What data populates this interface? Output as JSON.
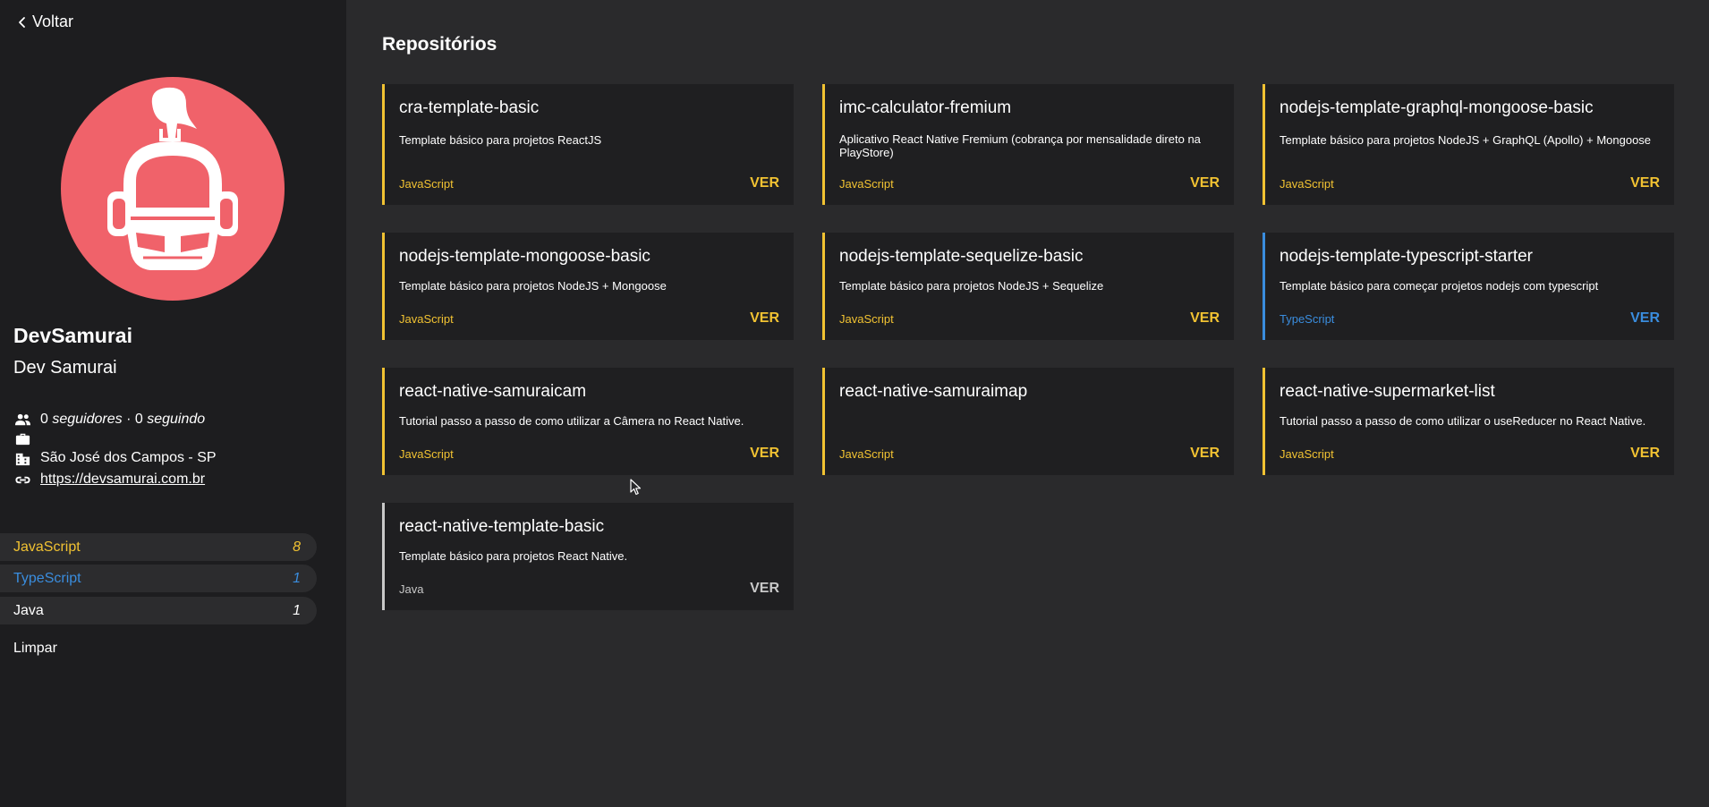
{
  "colors": {
    "javascript": "#f1c232",
    "typescript": "#3a8dde",
    "java": "#c8c8c8",
    "avatar_bg": "#f0626a"
  },
  "sidebar": {
    "back_label": "Voltar",
    "profile": {
      "login": "DevSamurai",
      "name": "Dev Samurai",
      "followers_count": "0",
      "followers_label": "seguidores",
      "separator": " · ",
      "following_count": "0",
      "following_label": "seguindo",
      "company": "",
      "location": "São José dos Campos - SP",
      "blog": "https://devsamurai.com.br"
    },
    "languages": [
      {
        "name": "JavaScript",
        "count": "8",
        "color": "#f1c232"
      },
      {
        "name": "TypeScript",
        "count": "1",
        "color": "#3a8dde"
      },
      {
        "name": "Java",
        "count": "1",
        "color": "#ffffff"
      }
    ],
    "clear_label": "Limpar"
  },
  "main": {
    "title": "Repositórios",
    "ver_label": "VER",
    "repos": [
      {
        "name": "cra-template-basic",
        "description": "Template básico para projetos ReactJS",
        "language": "JavaScript"
      },
      {
        "name": "imc-calculator-fremium",
        "description": "Aplicativo React Native Fremium (cobrança por mensalidade direto na PlayStore)",
        "language": "JavaScript"
      },
      {
        "name": "nodejs-template-graphql-mongoose-basic",
        "description": "Template básico para projetos NodeJS + GraphQL (Apollo) + Mongoose",
        "language": "JavaScript"
      },
      {
        "name": "nodejs-template-mongoose-basic",
        "description": "Template básico para projetos NodeJS + Mongoose",
        "language": "JavaScript"
      },
      {
        "name": "nodejs-template-sequelize-basic",
        "description": "Template básico para projetos NodeJS + Sequelize",
        "language": "JavaScript"
      },
      {
        "name": "nodejs-template-typescript-starter",
        "description": "Template básico para começar projetos nodejs com typescript",
        "language": "TypeScript"
      },
      {
        "name": "react-native-samuraicam",
        "description": "Tutorial passo a passo de como utilizar a Câmera no React Native.",
        "language": "JavaScript"
      },
      {
        "name": "react-native-samuraimap",
        "description": "",
        "language": "JavaScript"
      },
      {
        "name": "react-native-supermarket-list",
        "description": "Tutorial passo a passo de como utilizar o useReducer no React Native.",
        "language": "JavaScript"
      },
      {
        "name": "react-native-template-basic",
        "description": "Template básico para projetos React Native.",
        "language": "Java"
      }
    ]
  }
}
